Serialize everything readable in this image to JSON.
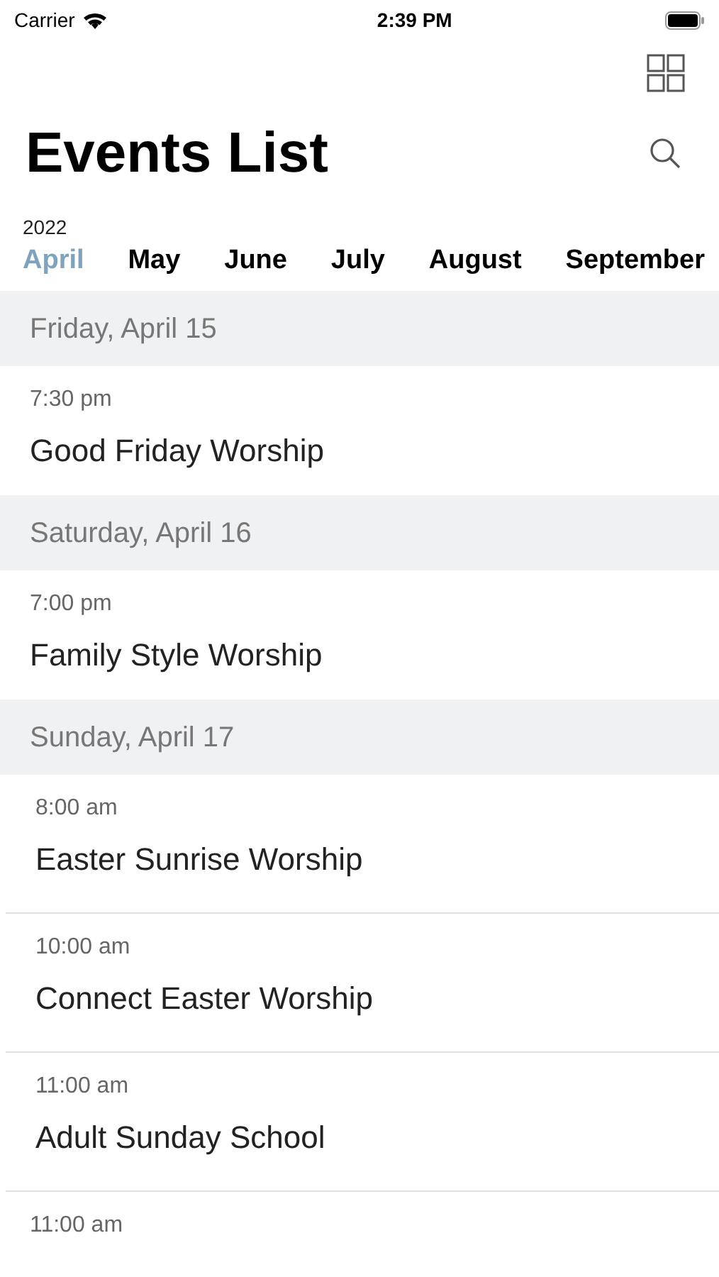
{
  "status_bar": {
    "carrier": "Carrier",
    "time": "2:39 PM"
  },
  "title": "Events List",
  "year": "2022",
  "months": [
    {
      "label": "April",
      "selected": true
    },
    {
      "label": "May",
      "selected": false
    },
    {
      "label": "June",
      "selected": false
    },
    {
      "label": "July",
      "selected": false
    },
    {
      "label": "August",
      "selected": false
    },
    {
      "label": "September",
      "selected": false
    }
  ],
  "days": [
    {
      "header": "Friday, April 15",
      "events": [
        {
          "time": "7:30 pm",
          "title": "Good Friday Worship"
        }
      ]
    },
    {
      "header": "Saturday, April 16",
      "events": [
        {
          "time": "7:00 pm",
          "title": "Family Style Worship"
        }
      ]
    },
    {
      "header": "Sunday, April 17",
      "events": [
        {
          "time": "8:00 am",
          "title": "Easter Sunrise Worship"
        },
        {
          "time": "10:00 am",
          "title": "Connect Easter Worship"
        },
        {
          "time": "11:00 am",
          "title": "Adult Sunday School"
        },
        {
          "time": "11:00 am"
        }
      ]
    }
  ]
}
